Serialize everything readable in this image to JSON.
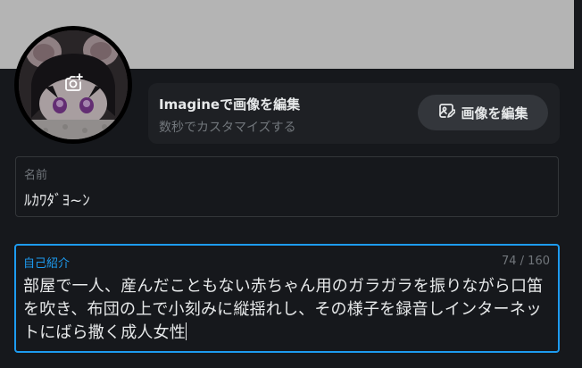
{
  "profile": {
    "avatar_alt": "プロフィール画像",
    "camera_icon": "camera-add-icon"
  },
  "imagine": {
    "title": "Imagineで画像を編集",
    "subtitle": "数秒でカスタマイズする",
    "button_label": "画像を編集",
    "button_icon": "image-edit-icon"
  },
  "name_field": {
    "label": "名前",
    "value": "ﾙｶﾜﾀﾞﾖ~ﾝ"
  },
  "bio_field": {
    "label": "自己紹介",
    "counter": "74 / 160",
    "value": "部屋で一人、産んだこともない赤ちゃん用のガラガラを振りながら口笛を吹き、布団の上で小刻みに縦揺れし、その様子を録音しインターネットにばら撒く成人女性"
  },
  "colors": {
    "background": "#16181c",
    "banner": "#b4b4b4",
    "accent": "#1d9bf0",
    "card": "#1e2024",
    "text": "#e7e9ea",
    "muted": "#71767b"
  }
}
